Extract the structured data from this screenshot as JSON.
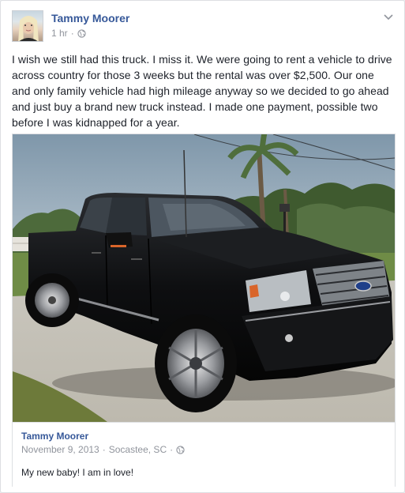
{
  "post": {
    "author": "Tammy Moorer",
    "time": "1 hr",
    "separator": "·",
    "audience_icon": "globe-icon",
    "menu_icon": "chevron-down-icon",
    "text": "I wish we still had this truck. I miss it. We were going to rent a vehicle to drive across country for those 3 weeks but the rental was over $2,500. Our one and only family vehicle had high mileage anyway so we decided to go ahead and just buy a brand new truck instead. I made one payment, possible two before I was kidnapped for a year."
  },
  "shared_post": {
    "author": "Tammy Moorer",
    "date": "November 9, 2013",
    "location": "Socastee, SC",
    "separator": "·",
    "text": "My new baby! I am in love!",
    "photo_subject": "black pickup truck"
  },
  "colors": {
    "link_blue": "#365899",
    "meta_gray": "#90949c",
    "text": "#1d2129",
    "border": "#dddfe2"
  }
}
